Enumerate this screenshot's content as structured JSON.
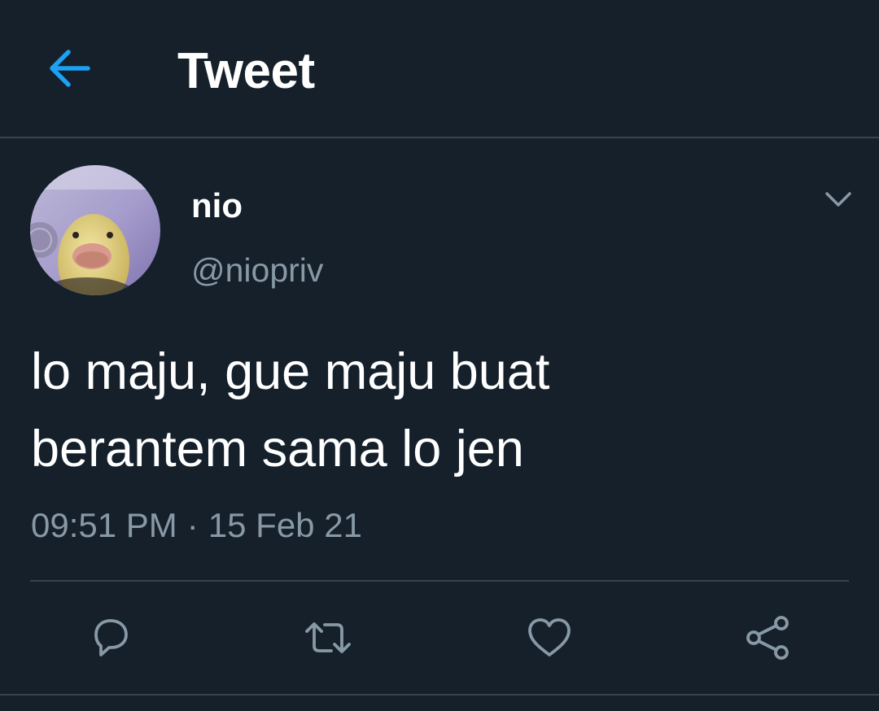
{
  "header": {
    "title": "Tweet",
    "back_icon": "back-arrow-icon"
  },
  "tweet": {
    "author": {
      "display_name": "nio",
      "handle": "@niopriv",
      "avatar_icon": "duck-avatar"
    },
    "text": "lo maju, gue maju buat\nberantem sama lo jen",
    "time": "09:51 PM",
    "separator": "·",
    "date": "15 Feb 21",
    "more_icon": "chevron-down-icon"
  },
  "actions": [
    {
      "name": "reply",
      "icon": "reply-icon"
    },
    {
      "name": "retweet",
      "icon": "retweet-icon"
    },
    {
      "name": "like",
      "icon": "heart-icon"
    },
    {
      "name": "share",
      "icon": "share-icon"
    }
  ],
  "colors": {
    "background": "#15202b",
    "divider": "#38444d",
    "accent": "#1da1f2",
    "secondary_text": "#8899a6",
    "primary_text": "#ffffff"
  }
}
